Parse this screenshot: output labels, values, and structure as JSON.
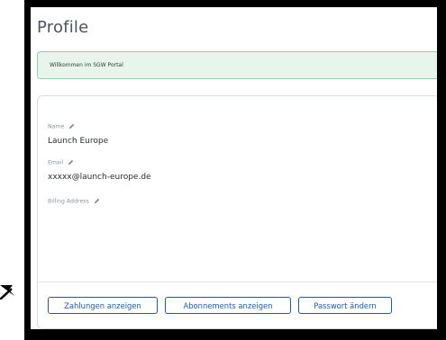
{
  "page": {
    "title": "Profile"
  },
  "alert": {
    "message": "Willkommen im SGW Portal"
  },
  "profile": {
    "name": {
      "label": "Name",
      "value": "Launch Europe"
    },
    "email": {
      "label": "Email",
      "value": "xxxxx@launch-europe.de"
    },
    "billing": {
      "label": "Billing Address",
      "value": ""
    }
  },
  "actions": {
    "payments": "Zahlungen anzeigen",
    "subscriptions": "Abonnements anzeigen",
    "password": "Passwort ändern"
  },
  "colors": {
    "accent": "#1c5cae",
    "alert_bg": "#e8f5ed",
    "alert_border": "#8fd1aa",
    "frame": "#000000"
  },
  "icons": {
    "edit": "pencil-icon",
    "annotation": "arrow-icon"
  }
}
